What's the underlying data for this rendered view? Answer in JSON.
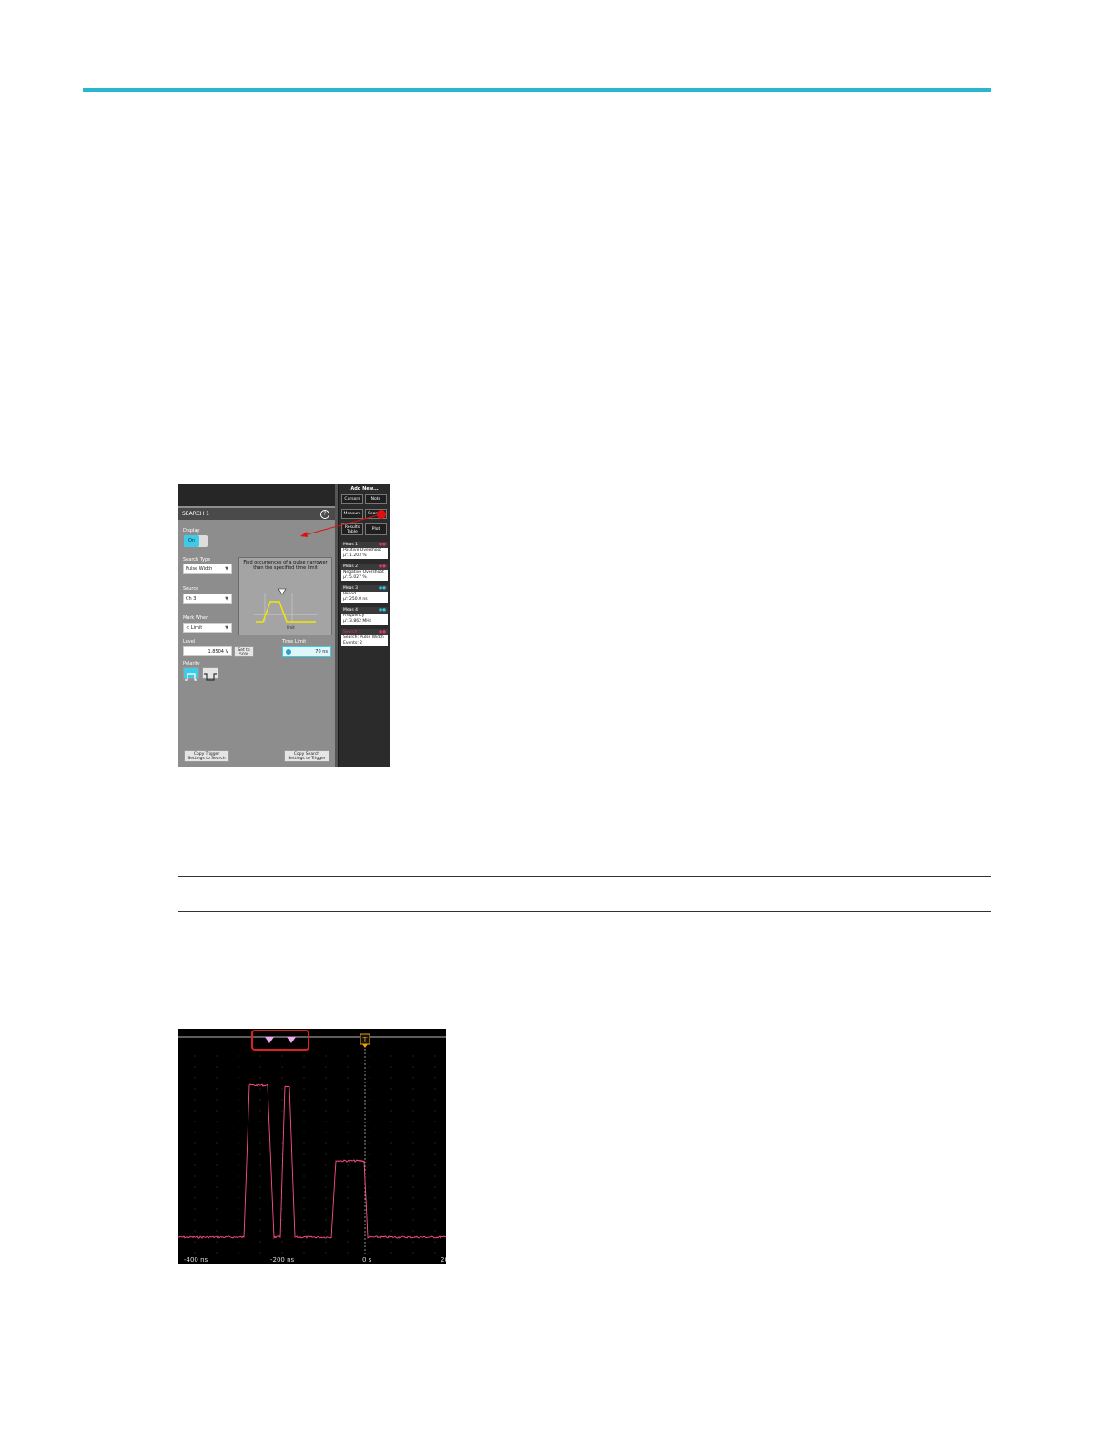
{
  "figure1": {
    "panel_title": "SEARCH 1",
    "display_label": "Display",
    "display_value": "On",
    "search_type_label": "Search Type",
    "search_type_value": "Pulse Width",
    "source_label": "Source",
    "source_value": "Ch 3",
    "mark_when_label": "Mark When",
    "mark_when_value": "< Limit",
    "info_text": "Find occurrences of a pulse narrower than the specified time limit",
    "info_caption": "limit",
    "level_label": "Level",
    "level_value": "1.8504 V",
    "set_to_50_label": "Set to 50%",
    "time_limit_label": "Time Limit",
    "time_limit_value": "70 ns",
    "polarity_label": "Polarity",
    "copy_trigger_label": "Copy Trigger Settings to Search",
    "copy_search_label": "Copy Search Settings to Trigger",
    "right_panel": {
      "add_new": "Add New...",
      "cursors": "Cursors",
      "note": "Note",
      "measure": "Measure",
      "search": "Search",
      "results_table": "Results Table",
      "plot": "Plot",
      "badges": [
        {
          "header": "Meas 1",
          "line1": "Positive Overshoot",
          "line2": "μ': 1.203 %",
          "color": "#e0337a"
        },
        {
          "header": "Meas 2",
          "line1": "Negative Overshoot",
          "line2": "μ': 5.027 %",
          "color": "#e0337a"
        },
        {
          "header": "Meas 3",
          "line1": "Period",
          "line2": "μ': 250.0 ns",
          "color": "#2ec7e0"
        },
        {
          "header": "Meas 4",
          "line1": "Frequency",
          "line2": "μ': 3.862 MHz",
          "color": "#2ec7e0"
        },
        {
          "header": "Search 1",
          "line1": "Search: Pulse Width",
          "line2": "Events: 2",
          "color": "#e0337a"
        }
      ]
    }
  },
  "figure2": {
    "trigger_marker": "T",
    "tick_labels": [
      "-400 ns",
      "-200 ns",
      "0 s",
      "20"
    ],
    "trace_color": "#ff4f8a",
    "search_marker_color": "#f3a8f0",
    "highlight_color": "#e02020"
  }
}
